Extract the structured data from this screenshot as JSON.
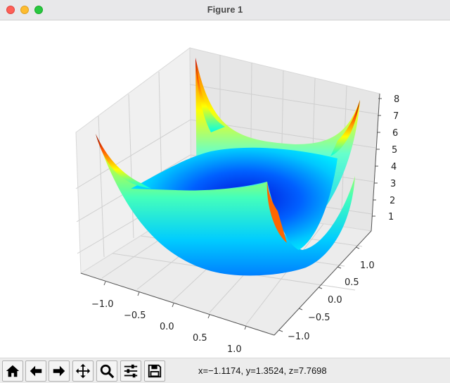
{
  "window": {
    "title": "Figure 1"
  },
  "chart_data": {
    "type": "surface",
    "title": "",
    "xlabel": "",
    "ylabel": "",
    "zlabel": "",
    "x_ticks": [
      "−1.0",
      "−0.5",
      "0.0",
      "0.5",
      "1.0"
    ],
    "y_ticks": [
      "−1.0",
      "−0.5",
      "0.0",
      "0.5",
      "1.0"
    ],
    "z_ticks": [
      "1",
      "2",
      "3",
      "4",
      "5",
      "6",
      "7",
      "8"
    ],
    "xlim": [
      -1.3,
      1.3
    ],
    "ylim": [
      -1.3,
      1.3
    ],
    "zlim": [
      0,
      8
    ],
    "colormap": "jet",
    "surface": "trisurf, bowl with raised corners (approx. z = x^4 + y^4 style)",
    "grid": true
  },
  "toolbar": {
    "buttons": [
      {
        "icon": "home-icon",
        "name": "home-button"
      },
      {
        "icon": "back-arrow-icon",
        "name": "back-button"
      },
      {
        "icon": "forward-arrow-icon",
        "name": "forward-button"
      },
      {
        "icon": "pan-icon",
        "name": "pan-button"
      },
      {
        "icon": "zoom-icon",
        "name": "zoom-button"
      },
      {
        "icon": "sliders-icon",
        "name": "configure-subplots-button"
      },
      {
        "icon": "save-icon",
        "name": "save-button"
      }
    ],
    "coords": "x=−1.1174, y=1.3524, z=7.7698"
  }
}
